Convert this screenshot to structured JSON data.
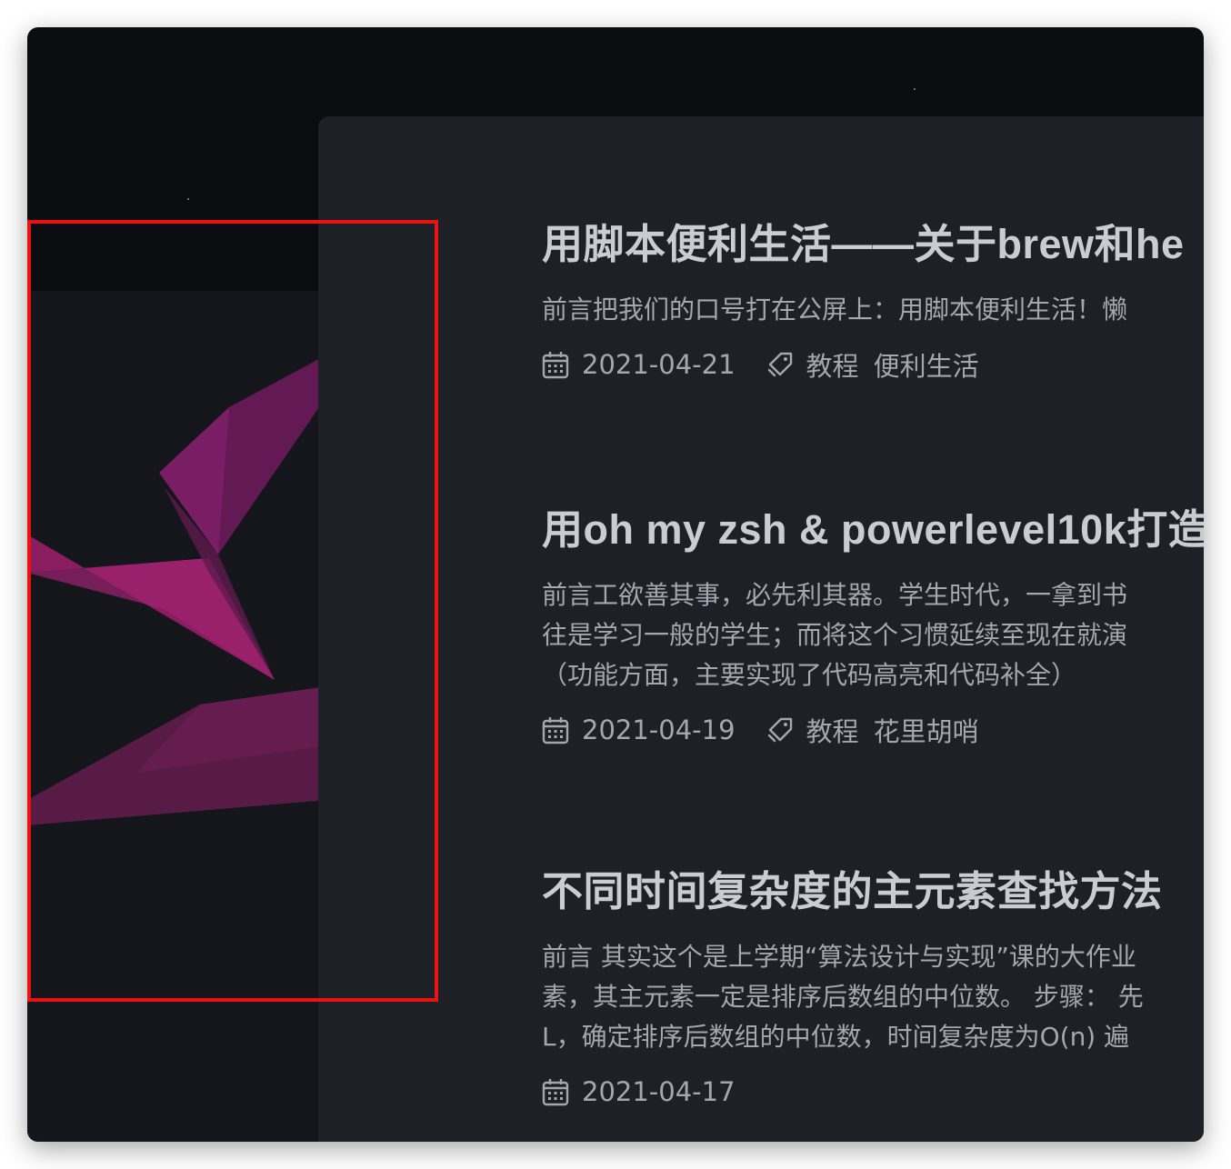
{
  "colors": {
    "page_bg": "#0b0c0f",
    "card_bg": "#1d2027",
    "title_text": "#c9ccd1",
    "body_text": "#a3a7ae",
    "highlight_border": "#ee1111",
    "ribbon": "#8b1a66"
  },
  "posts": [
    {
      "title": "用脚本便利生活——关于brew和he",
      "excerpt_lines": [
        "前言把我们的口号打在公屏上：用脚本便利生活！懒"
      ],
      "date": "2021-04-21",
      "tags": [
        "教程",
        "便利生活"
      ],
      "date_icon": "calendar-icon",
      "tag_icon": "tag-icon"
    },
    {
      "title": "用oh my zsh & powerlevel10k打造",
      "excerpt_lines": [
        "前言工欲善其事，必先利其器。学生时代，一拿到书",
        "往是学习一般的学生；而将这个习惯延续至现在就演",
        "（功能方面，主要实现了代码高亮和代码补全）"
      ],
      "date": "2021-04-19",
      "tags": [
        "教程",
        "花里胡哨"
      ],
      "date_icon": "calendar-icon",
      "tag_icon": "tag-icon"
    },
    {
      "title": "不同时间复杂度的主元素查找方法",
      "excerpt_lines": [
        "前言 其实这个是上学期“算法设计与实现”课的大作业",
        "素，其主元素一定是排序后数组的中位数。 步骤： 先",
        "L，确定排序后数组的中位数，时间复杂度为O(n) 遍"
      ],
      "date": "2021-04-17",
      "tags": [],
      "date_icon": "calendar-icon",
      "tag_icon": "tag-icon"
    }
  ]
}
